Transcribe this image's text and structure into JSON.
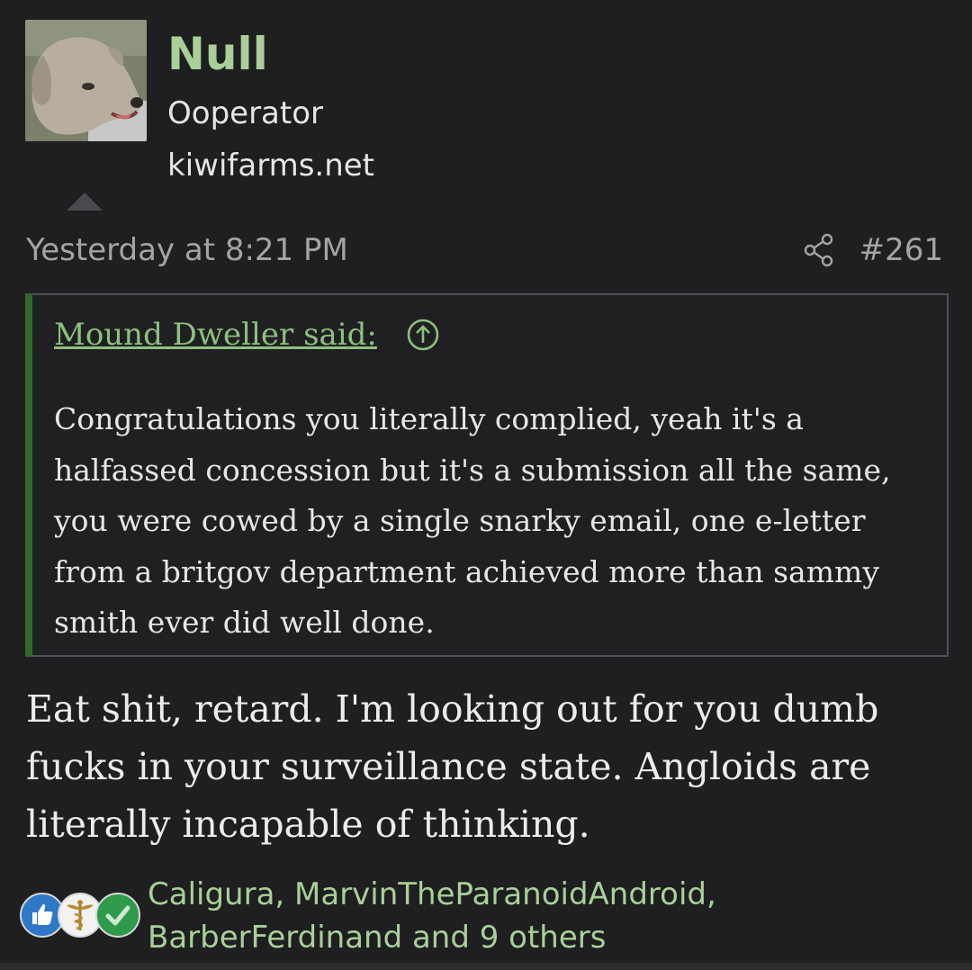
{
  "author": {
    "name": "Null",
    "title": "Ooperator",
    "extra": "kiwifarms.net"
  },
  "post": {
    "date": "Yesterday at 8:21 PM",
    "number": "#261"
  },
  "quote": {
    "attribution": "Mound Dweller said:",
    "text": "Congratulations you literally complied, yeah it's a halfassed concession but it's a submission all the same, you were cowed by a single snarky email, one e-letter from a britgov department achieved more than sammy smith ever did well done."
  },
  "message": {
    "text": "Eat shit, retard. I'm looking out for you dumb fucks in your surveillance state. Angloids are literally incapable of thinking."
  },
  "reactions": {
    "icons": [
      "thumbs-up-icon",
      "caduceus-icon",
      "checkmark-icon"
    ],
    "users_text": "Caligura, MarvinTheParanoidAndroid, BarberFerdinand and 9 others"
  },
  "colors": {
    "background": "#1f1f21",
    "username": "#a8d098",
    "link": "#8cc07e",
    "quote_bar": "#2e6a2a",
    "meta": "#a4a4a4"
  }
}
